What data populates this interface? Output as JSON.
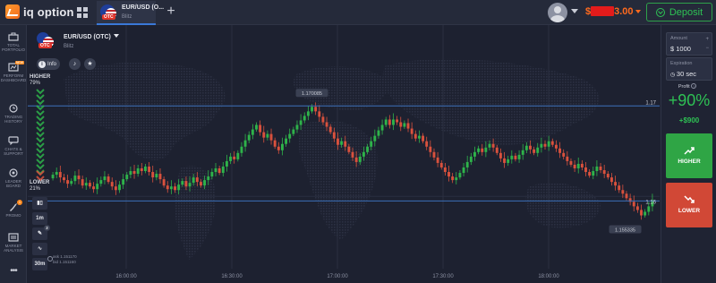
{
  "topbar": {
    "logo_text": "iq option",
    "tab_title": "EUR/USD (O...",
    "tab_subtitle": "Blitz",
    "otc_tag": "OTC",
    "balance_prefix": "$",
    "balance_suffix": "3.00",
    "deposit_label": "Deposit"
  },
  "sidebar": {
    "items": [
      {
        "label": "TOTAL PORTFOLIO",
        "icon": "briefcase-icon"
      },
      {
        "label": "PERFORM DASHBOARD",
        "icon": "dashboard-icon",
        "badge": "NEW"
      },
      {
        "label": "TRADING HISTORY",
        "icon": "history-icon"
      },
      {
        "label": "CHATS & SUPPORT",
        "icon": "chat-icon"
      },
      {
        "label": "LEADER BOARD",
        "icon": "trophy-icon"
      },
      {
        "label": "PROMO",
        "icon": "rocket-icon",
        "badge": "1"
      },
      {
        "label": "MARKET ANALYSIS",
        "icon": "analysis-icon"
      },
      {
        "label": "",
        "icon": "more-icon"
      }
    ]
  },
  "chart": {
    "asset_name": "EUR/USD (OTC)",
    "asset_type": "Blitz",
    "info_label": "Info",
    "higher_label": "HIGHER",
    "higher_pct": "79%",
    "lower_label": "LOWER",
    "lower_pct": "21%",
    "tool_timeframe": "1m",
    "tool_period": "30m",
    "tool_badge": "2",
    "ask_label": "ask 1.151170",
    "bid_label": "bid 1.151160",
    "price_high_label": "1.170085",
    "price_low_label": "1.155335",
    "right_label_top": "1.17",
    "right_label_mid": "1.16"
  },
  "chart_data": {
    "type": "candlestick",
    "x_tick_labels": [
      "16:00:00",
      "16:30:00",
      "17:00:00",
      "17:30:00",
      "18:00:00"
    ],
    "y_tick_labels": [
      "1.17",
      "1.16"
    ],
    "y_range": [
      1.153,
      1.173
    ],
    "grid": true,
    "candles_close": [
      1.1624,
      1.1627,
      1.1621,
      1.1618,
      1.1614,
      1.1617,
      1.1623,
      1.1619,
      1.1612,
      1.1615,
      1.1611,
      1.1608,
      1.1614,
      1.1618,
      1.1622,
      1.1616,
      1.1611,
      1.1607,
      1.1613,
      1.1619,
      1.1624,
      1.1628,
      1.1625,
      1.1631,
      1.1628,
      1.1633,
      1.1627,
      1.1621,
      1.1625,
      1.1619,
      1.1612,
      1.1608,
      1.1611,
      1.1607,
      1.1613,
      1.1617,
      1.1611,
      1.1615,
      1.1621,
      1.1616,
      1.1612,
      1.1618,
      1.1622,
      1.1627,
      1.1631,
      1.1626,
      1.1633,
      1.1639,
      1.1644,
      1.1641,
      1.1648,
      1.1655,
      1.1662,
      1.1668,
      1.1674,
      1.1679,
      1.1671,
      1.1665,
      1.1669,
      1.1662,
      1.1655,
      1.1651,
      1.1658,
      1.1664,
      1.1669,
      1.1674,
      1.1679,
      1.1684,
      1.1689,
      1.1694,
      1.1699,
      1.1694,
      1.1688,
      1.1682,
      1.1677,
      1.1671,
      1.1664,
      1.1657,
      1.1661,
      1.1655,
      1.1649,
      1.1643,
      1.1638,
      1.1644,
      1.1649,
      1.1655,
      1.1661,
      1.1667,
      1.1673,
      1.1679,
      1.1685,
      1.1679,
      1.1685,
      1.1682,
      1.1677,
      1.1681,
      1.1675,
      1.1669,
      1.1664,
      1.1667,
      1.1661,
      1.1655,
      1.1649,
      1.1643,
      1.1637,
      1.1632,
      1.1627,
      1.1622,
      1.1618,
      1.1621,
      1.1626,
      1.1632,
      1.1638,
      1.1644,
      1.1649,
      1.1653,
      1.1649,
      1.1654,
      1.1658,
      1.1654,
      1.1648,
      1.1642,
      1.1637,
      1.1641,
      1.1645,
      1.1641,
      1.1646,
      1.1651,
      1.1656,
      1.1652,
      1.1648,
      1.1654,
      1.1658,
      1.1655,
      1.1661,
      1.1657,
      1.1653,
      1.1648,
      1.1644,
      1.1639,
      1.1635,
      1.1631,
      1.1636,
      1.1632,
      1.1627,
      1.1623,
      1.1628,
      1.1633,
      1.1629,
      1.1625,
      1.1621,
      1.1616,
      1.1612,
      1.1607,
      1.1603,
      1.1598,
      1.1594,
      1.1589,
      1.1585,
      1.1579,
      1.1583,
      1.1589,
      1.1596
    ],
    "annotations": [
      {
        "text": "1.170085",
        "kind": "max"
      },
      {
        "text": "1.155335",
        "kind": "min"
      }
    ]
  },
  "right_panel": {
    "amount_label": "Amount",
    "amount_value": "$ 1000",
    "expiration_label": "Expiration",
    "expiration_value": "30 sec",
    "profit_label": "Profit",
    "profit_pct": "+90%",
    "profit_amount": "+$900",
    "higher_button": "HIGHER",
    "lower_button": "LOWER"
  },
  "colors": {
    "up": "#2eb34a",
    "down": "#d9513d",
    "accent_blue": "#3b6fb8",
    "deposit_green": "#2ec154",
    "balance_orange": "#ff6a1e"
  }
}
